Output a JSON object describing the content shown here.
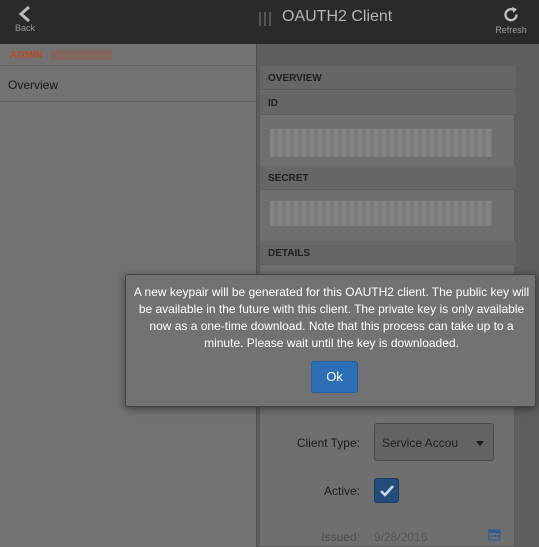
{
  "topbar": {
    "back_label": "Back",
    "title": "OAUTH2 Client",
    "refresh_label": "Refresh"
  },
  "left_panel": {
    "admin_label": "ADMIN",
    "overview_label": "Overview"
  },
  "detail": {
    "overview_heading": "OVERVIEW",
    "id_heading": "ID",
    "secret_heading": "SECRET",
    "details_heading": "DETAILS",
    "client_type_label": "Client Type:",
    "client_type_value": "Service Accou",
    "active_label": "Active:",
    "active_checked": true,
    "issued_label": "Issued:",
    "issued_value": "9/28/2016"
  },
  "modal": {
    "message": "A new keypair will be generated for this OAUTH2 client. The public key will be available in the future with this client. The private key is only available now as a one-time download. Note that this process can take up to a minute. Please wait until the key is downloaded.",
    "ok_label": "Ok"
  },
  "colors": {
    "accent": "#2c6fb6",
    "admin_label": "#b64a23",
    "topbar": "#2a2a2a"
  },
  "icons": [
    "back-arrow-icon",
    "drag-handle-icon",
    "refresh-icon",
    "checkmark-icon",
    "calendar-icon",
    "chevron-down-icon"
  ]
}
